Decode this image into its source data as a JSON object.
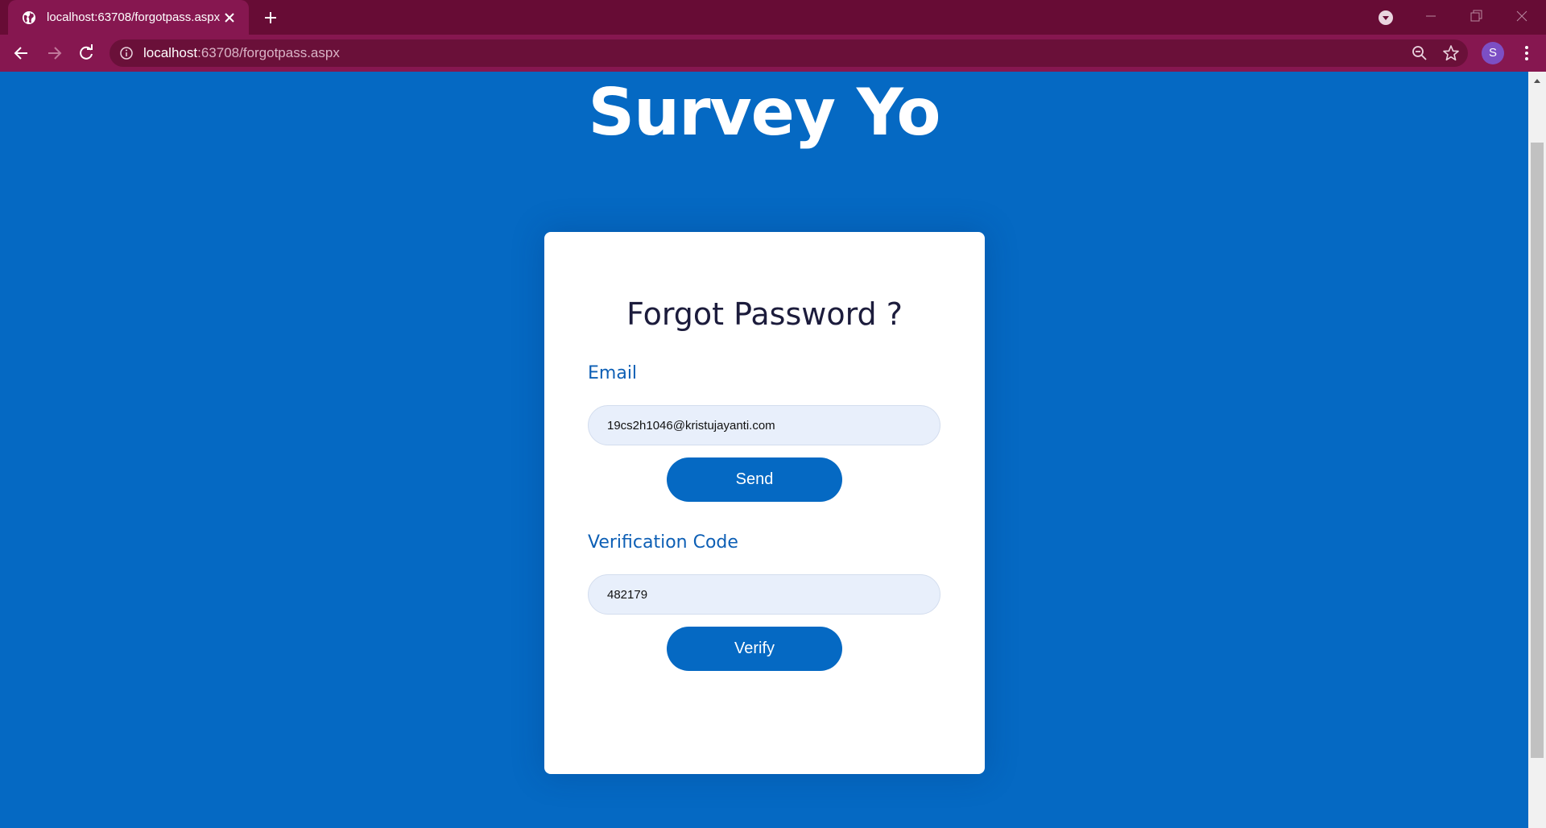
{
  "browser": {
    "tab_title": "localhost:63708/forgotpass.aspx",
    "url_host": "localhost",
    "url_path": ":63708/forgotpass.aspx",
    "profile_initial": "S"
  },
  "page": {
    "brand": "Survey Yo",
    "heading": "Forgot Password ?",
    "email_label": "Email",
    "email_value": "19cs2h1046@kristujayanti.com",
    "send_label": "Send",
    "code_label": "Verification Code",
    "code_value": "482179",
    "verify_label": "Verify"
  },
  "colors": {
    "tab_strip": "#670c35",
    "toolbar": "#861750",
    "page_background": "#0569c3",
    "button": "#0569c3",
    "label": "#0d5fb5",
    "input_background": "#e8effb"
  },
  "icons": [
    "globe-icon",
    "close-icon",
    "plus-icon",
    "tab-search-icon",
    "minimize-icon",
    "restore-icon",
    "window-close-icon",
    "back-arrow-icon",
    "forward-arrow-icon",
    "reload-icon",
    "info-icon",
    "zoom-icon",
    "star-icon",
    "kebab-menu-icon"
  ]
}
